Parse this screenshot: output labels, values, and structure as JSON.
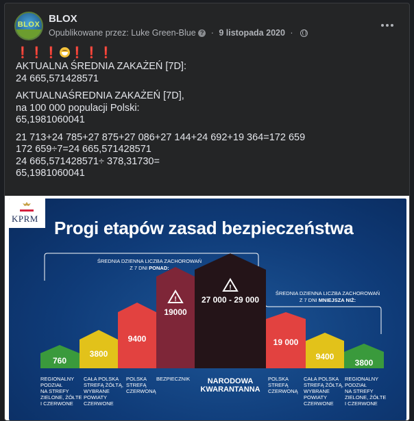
{
  "post": {
    "page_name": "BLOX",
    "avatar_text": "BLOX",
    "published_by_prefix": "Opublikowane przez: ",
    "author": "Luke Green-Blue",
    "date": "9 listopada 2020",
    "badge_glyph": "?",
    "icons": [
      "verified-badge-icon",
      "globe-icon",
      "more-options-icon",
      "smiley-emoji-icon"
    ],
    "exclamations_left": "❗❗❗",
    "exclamations_right": "❗❗❗",
    "lines": {
      "l1": "AKTUALNA ŚREDNIA ZAKAŻEŃ [7D]:",
      "l2": "24 665,571428571",
      "l3": "AKTUALNAŚREDNIA ZAKAŻEŃ [7D],",
      "l4": "na 100 000 populacji Polski:",
      "l5": "65,1981060041",
      "l6": "21 713+24 785+27 875+27 086+27 144+24 692+19 364=172 659",
      "l7": "172 659÷7=24 665,571428571",
      "l8": "24 665,571428571÷ 378,31730=",
      "l9": "65,1981060041"
    }
  },
  "infographic": {
    "logo": "KPRM",
    "title": "Progi etapów zasad bezpieczeństwa",
    "left_bracket_text_1": "ŚREDNIA DZIENNA LICZBA ZACHOROWAŃ",
    "left_bracket_text_2a": "Z 7 DNI ",
    "left_bracket_text_2b": "PONAD:",
    "right_bracket_text_1": "ŚREDNIA DZIENNA LICZBA ZACHOROWAŃ",
    "right_bracket_text_2a": "Z 7 DNI ",
    "right_bracket_text_2b": "MNIEJSZA NIŻ:",
    "bars": [
      {
        "value": "760",
        "color": "#3a9a3c"
      },
      {
        "value": "3800",
        "color": "#e2c21a"
      },
      {
        "value": "9400",
        "color": "#e24240"
      },
      {
        "value": "19000",
        "color": "#7e2638"
      },
      {
        "value": "27 000 - 29 000",
        "color": "#241418"
      },
      {
        "value": "19 000",
        "color": "#e24240"
      },
      {
        "value": "9400",
        "color": "#e2c21a"
      },
      {
        "value": "3800",
        "color": "#3a9a3c"
      }
    ],
    "captions": [
      [
        "REGIONALNY",
        "PODZIAŁ",
        "NA STREFY",
        "ZIELONE, ŻÓŁTE",
        "I CZERWONE"
      ],
      [
        "CAŁA POLSKA",
        "STREFĄ ŻÓŁTĄ,",
        "WYBRANE",
        "POWIATY",
        "CZERWONE"
      ],
      [
        "POLSKA",
        "STREFĄ",
        "CZERWONĄ"
      ],
      [
        "BEZPIECZNIK"
      ],
      [
        "NARODOWA",
        "KWARANTANNA"
      ],
      [
        "POLSKA",
        "STREFĄ",
        "CZERWONĄ"
      ],
      [
        "CAŁA POLSKA",
        "STREFĄ ŻÓŁTĄ,",
        "WYBRANE",
        "POWIATY",
        "CZERWONE"
      ],
      [
        "REGIONALNY",
        "PODZIAŁ",
        "NA STREFY",
        "ZIELONE, ŻÓŁTE",
        "I CZERWONE"
      ]
    ]
  }
}
